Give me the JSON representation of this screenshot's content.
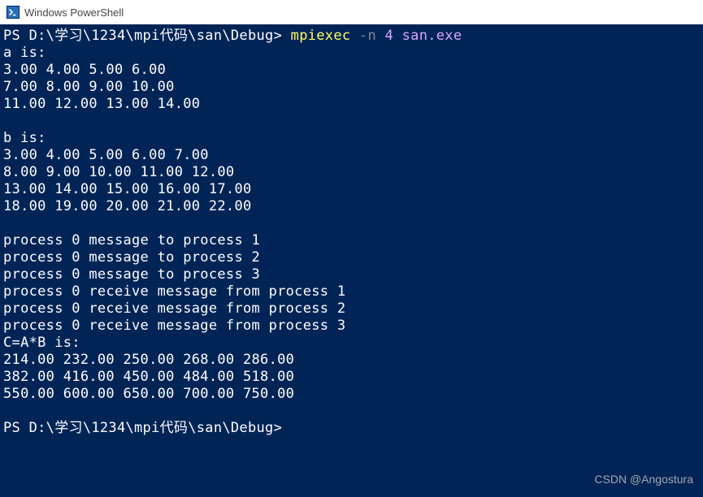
{
  "window": {
    "title": "Windows PowerShell"
  },
  "prompt1": {
    "ps": "PS ",
    "path": "D:\\学习\\1234\\mpi代码\\san\\Debug> ",
    "cmd": "mpiexec ",
    "flag": "-n",
    "num": " 4 ",
    "arg": "san.exe"
  },
  "output": {
    "line01": "a is:",
    "line02": "3.00 4.00 5.00 6.00",
    "line03": "7.00 8.00 9.00 10.00",
    "line04": "11.00 12.00 13.00 14.00",
    "line05": "",
    "line06": "b is:",
    "line07": "3.00 4.00 5.00 6.00 7.00",
    "line08": "8.00 9.00 10.00 11.00 12.00",
    "line09": "13.00 14.00 15.00 16.00 17.00",
    "line10": "18.00 19.00 20.00 21.00 22.00",
    "line11": "",
    "line12": "process 0 message to process 1",
    "line13": "process 0 message to process 2",
    "line14": "process 0 message to process 3",
    "line15": "process 0 receive message from process 1",
    "line16": "process 0 receive message from process 2",
    "line17": "process 0 receive message from process 3",
    "line18": "C=A*B is:",
    "line19": "214.00 232.00 250.00 268.00 286.00",
    "line20": "382.00 416.00 450.00 484.00 518.00",
    "line21": "550.00 600.00 650.00 700.00 750.00",
    "line22": ""
  },
  "prompt2": {
    "ps": "PS ",
    "path": "D:\\学习\\1234\\mpi代码\\san\\Debug> "
  },
  "watermark": "CSDN @Angostura"
}
